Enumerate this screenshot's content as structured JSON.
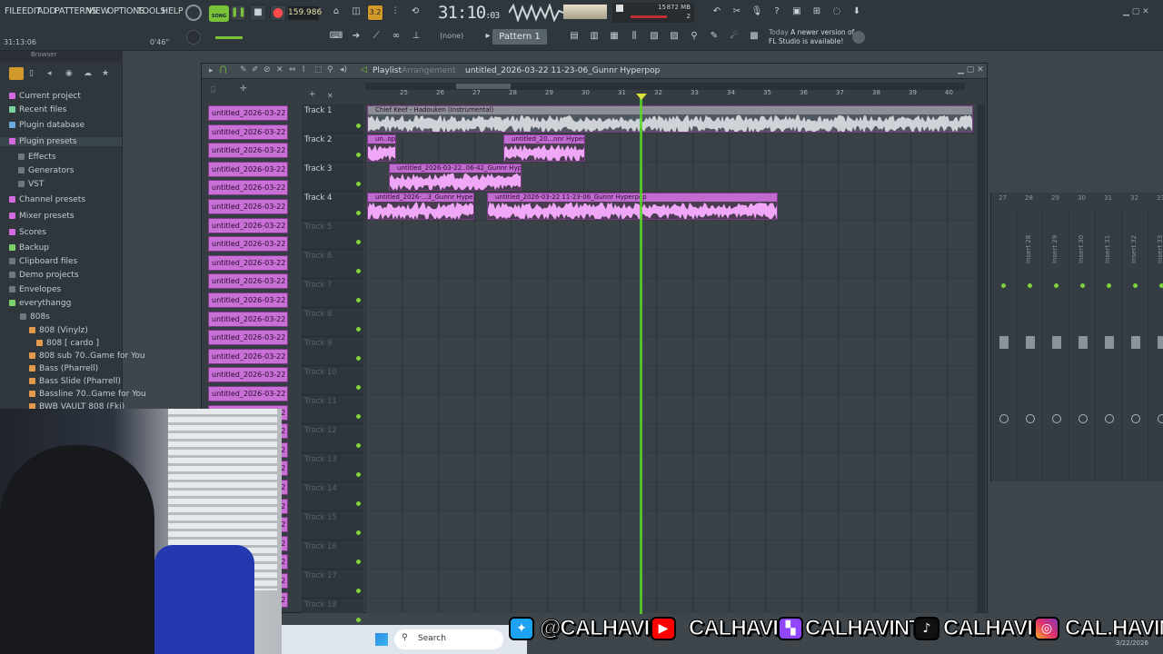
{
  "menu": [
    "FILE",
    "EDIT",
    "ADD",
    "PATTERNS",
    "VIEW",
    "OPTIONS",
    "TOOLS",
    "HELP"
  ],
  "transport": {
    "song_label": "SONG",
    "bpm": "159.986",
    "time": "31:10",
    "time_ticks": "03",
    "time_sub": "B:S:T",
    "cpu": "15",
    "ram": "872 MB",
    "voices": "2"
  },
  "hint": {
    "left": "31:13:06",
    "right": "0'46\""
  },
  "pattern_selector": "Pattern 1",
  "none_selector": "(none)",
  "news": {
    "line1": "Today",
    "line2": "A newer version of",
    "line3": "FL Studio is available!"
  },
  "browser": {
    "title": "Browser",
    "items": [
      {
        "label": "Current project",
        "color": "#d46ae0"
      },
      {
        "label": "Recent files",
        "color": "#7dd3a0"
      },
      {
        "label": "Plugin database",
        "color": "#6aa8e0"
      },
      {
        "label": "Plugin presets",
        "color": "#d46ae0"
      },
      {
        "label": "Effects",
        "color": "#6e777d"
      },
      {
        "label": "Generators",
        "color": "#6e777d"
      },
      {
        "label": "VST",
        "color": "#6e777d"
      },
      {
        "label": "Channel presets",
        "color": "#d46ae0"
      },
      {
        "label": "Mixer presets",
        "color": "#d46ae0"
      },
      {
        "label": "Scores",
        "color": "#d46ae0"
      },
      {
        "label": "Backup",
        "color": "#7dd36a"
      },
      {
        "label": "Clipboard files",
        "color": "#6e777d"
      },
      {
        "label": "Demo projects",
        "color": "#6e777d"
      },
      {
        "label": "Envelopes",
        "color": "#6e777d"
      },
      {
        "label": "everythangg",
        "color": "#7dd36a"
      },
      {
        "label": "808s",
        "color": "#6e777d"
      },
      {
        "label": "808 (Vinylz)",
        "color": "#e09a4a"
      },
      {
        "label": "808 [ cardo ]",
        "color": "#e09a4a"
      },
      {
        "label": "808 sub 70..Game for You",
        "color": "#e09a4a"
      },
      {
        "label": "Bass (Pharrell)",
        "color": "#e09a4a"
      },
      {
        "label": "Bass Slide (Pharrell)",
        "color": "#e09a4a"
      },
      {
        "label": "Bassline 70..Game for You",
        "color": "#e09a4a"
      },
      {
        "label": "BWB VAULT 808 (Fki)",
        "color": "#e09a4a"
      }
    ]
  },
  "playlist": {
    "title": "Playlist",
    "subtitle": "Arrangement",
    "project": "untitled_2026-03-22 11-23-06_Gunnr Hyperpop",
    "pattern_clip_label": "untitled_2026-03-22 11-...",
    "bars": [
      "25",
      "26",
      "27",
      "28",
      "29",
      "30",
      "31",
      "32",
      "33",
      "34",
      "35",
      "36",
      "37",
      "38",
      "39",
      "40"
    ],
    "tracks": [
      "Track 1",
      "Track 2",
      "Track 3",
      "Track 4",
      "Track 5",
      "Track 6",
      "Track 7",
      "Track 8",
      "Track 9",
      "Track 10",
      "Track 11",
      "Track 12",
      "Track 13",
      "Track 14",
      "Track 15",
      "Track 16",
      "Track 17",
      "Track 18"
    ],
    "clips": [
      {
        "label": "Chief Keef - Hadouken (Instrumental)",
        "track": 0,
        "start": 0,
        "len": 667,
        "kind": "grey"
      },
      {
        "label": "un..op",
        "track": 1,
        "start": 0,
        "len": 32,
        "kind": "pink"
      },
      {
        "label": "untitled_20...nnr Hyperpop",
        "track": 1,
        "start": 150,
        "len": 90,
        "kind": "pink"
      },
      {
        "label": "untitled_2026-03-22..06-42_Gunnr Hyperpop",
        "track": 2,
        "start": 24,
        "len": 146,
        "kind": "pink"
      },
      {
        "label": "untitled_2026-...3_Gunnr Hyperpop",
        "track": 3,
        "start": 0,
        "len": 118,
        "kind": "pink"
      },
      {
        "label": "untitled_2026-03-22 11-23-06_Gunnr Hyperpop",
        "track": 3,
        "start": 132,
        "len": 320,
        "kind": "pink"
      }
    ]
  },
  "mixer": {
    "inserts": [
      "27",
      "28",
      "29",
      "30",
      "31",
      "32",
      "33"
    ],
    "labels": [
      "Insert 28",
      "Insert 29",
      "Insert 30",
      "Insert 31",
      "Insert 32",
      "Insert 33"
    ]
  },
  "taskbar": {
    "search": "Search",
    "date": "3/22/2026"
  },
  "social": [
    "@CALHAVIN",
    "CALHAVIN",
    "CALHAVINTV",
    "CALHAVIN",
    "CAL.HAVIN"
  ],
  "colors": {
    "accent": "#79c23a",
    "clip_pink": "#c870d6",
    "wave": "#f0a7f8",
    "playhead": "#58d62c"
  }
}
